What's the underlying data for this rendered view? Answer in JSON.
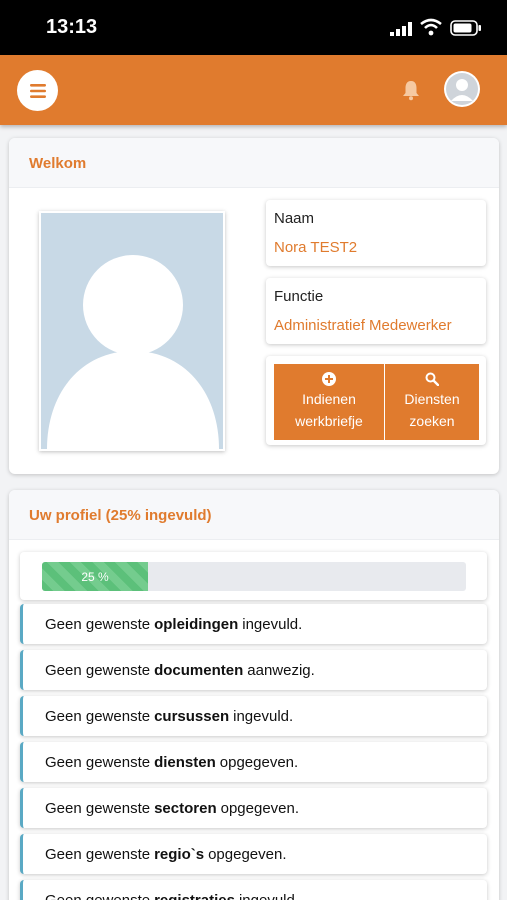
{
  "status_bar": {
    "time": "13:13"
  },
  "colors": {
    "accent": "#e07b2e",
    "progress": "#5cc07a",
    "item_border": "#5aa9c4"
  },
  "header": {
    "menu_icon": "menu-icon",
    "bell_icon": "bell-icon",
    "avatar_icon": "user-avatar-icon"
  },
  "welcome": {
    "title": "Welkom",
    "name_label": "Naam",
    "name_value": "Nora TEST2",
    "function_label": "Functie",
    "function_value": "Administratief Medewerker",
    "button1_line1": "Indienen",
    "button1_line2": "werkbriefje",
    "button2_line1": "Diensten",
    "button2_line2": "zoeken"
  },
  "profile": {
    "title": "Uw profiel (25% ingevuld)",
    "progress_label": "25 %",
    "progress_fraction": 0.25,
    "items": [
      {
        "pre": "Geen gewenste",
        "key": "opleidingen",
        "post": "ingevuld."
      },
      {
        "pre": "Geen gewenste",
        "key": "documenten",
        "post": "aanwezig."
      },
      {
        "pre": "Geen gewenste",
        "key": "cursussen",
        "post": "ingevuld."
      },
      {
        "pre": "Geen gewenste",
        "key": "diensten",
        "post": "opgegeven."
      },
      {
        "pre": "Geen gewenste",
        "key": "sectoren",
        "post": "opgegeven."
      },
      {
        "pre": "Geen gewenste",
        "key": "regio`s",
        "post": "opgegeven."
      },
      {
        "pre": "Geen gewenste",
        "key": "registraties",
        "post": "ingevuld."
      }
    ]
  }
}
